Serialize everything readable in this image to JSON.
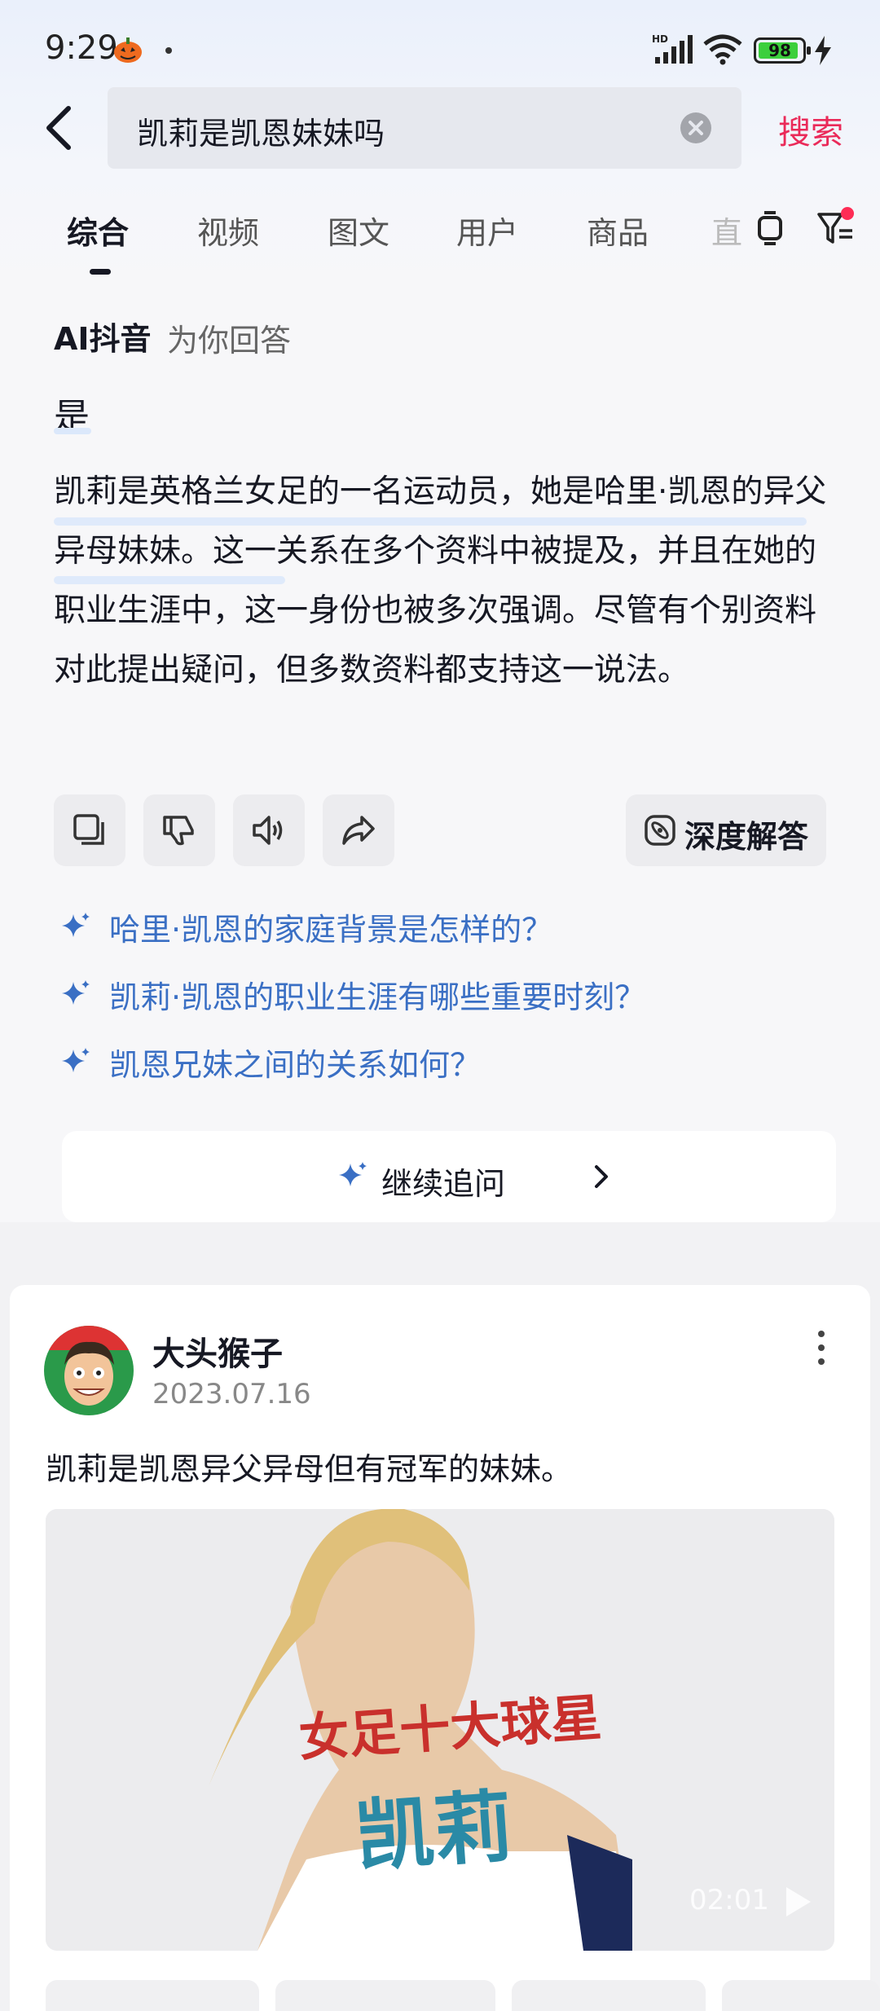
{
  "status": {
    "time": "9:29",
    "network": "HD",
    "battery": "98"
  },
  "search": {
    "query": "凯莉是凯恩妹妹吗",
    "button_label": "搜索"
  },
  "tabs": [
    "综合",
    "视频",
    "图文",
    "用户",
    "商品",
    "直"
  ],
  "ai": {
    "brand": "AI抖音",
    "subtitle": "为你回答",
    "short_answer": "是",
    "body": "凯莉是英格兰女足的一名运动员，她是哈里·凯恩的异父异母妹妹。这一关系在多个资料中被提及，并且在她的职业生涯中，这一身份也被多次强调。尽管有个别资料对此提出疑问，但多数资料都支持这一说法。",
    "deep_answer_label": "深度解答",
    "suggestions": [
      "哈里·凯恩的家庭背景是怎样的？",
      "凯莉·凯恩的职业生涯有哪些重要时刻？",
      "凯恩兄妹之间的关系如何？"
    ],
    "follow_up_label": "继续追问"
  },
  "post": {
    "author": "大头猴子",
    "date": "2023.07.16",
    "text": "凯莉是凯恩异父异母但有冠军的妹妹。",
    "thumb_title_top": "女足十大球星",
    "thumb_title_main": "凯莉",
    "duration": "02:01"
  },
  "colors": {
    "accent": "#ea2a59",
    "link": "#3a6fc4",
    "battery_fill": "#3ccf3c"
  }
}
